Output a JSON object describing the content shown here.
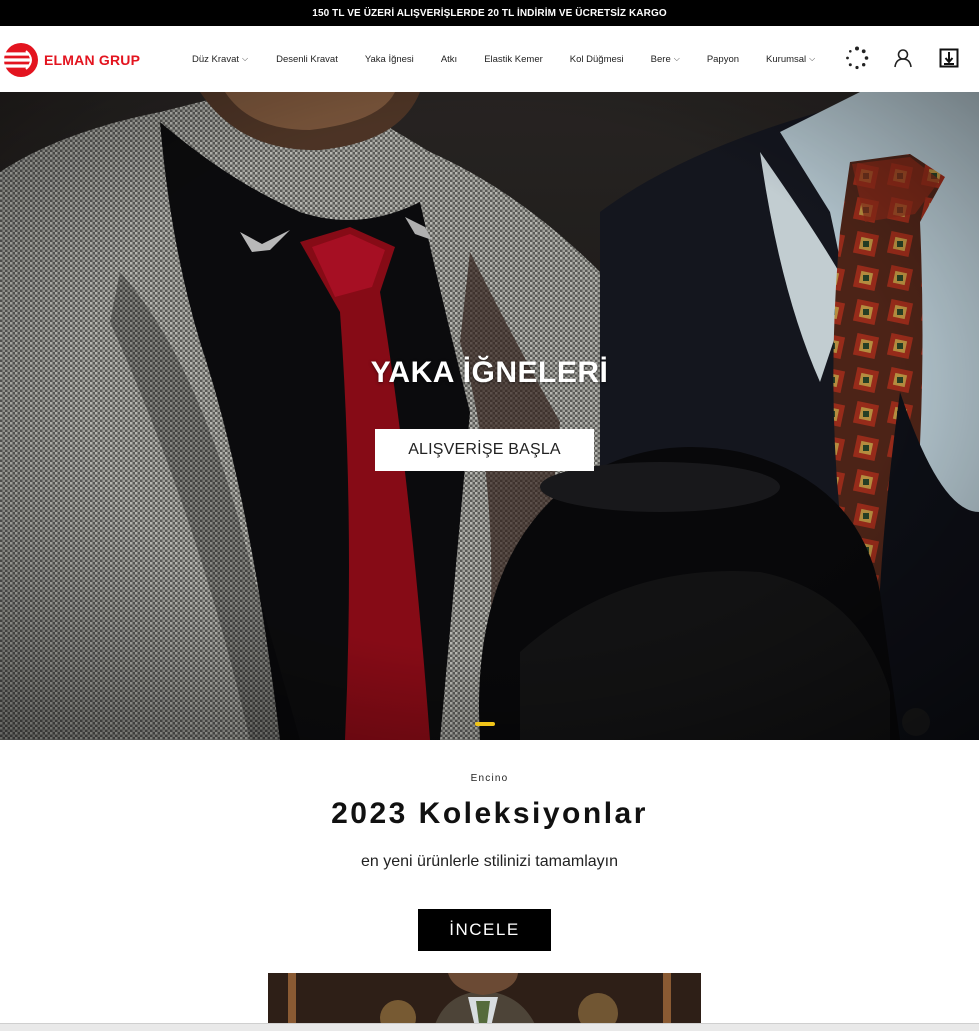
{
  "announcement": "150 TL VE ÜZERİ ALIŞVERİŞLERDE 20 TL İNDİRİM VE ÜCRETSİZ KARGO",
  "brand": {
    "name": "ELMAN GRUP",
    "color": "#e3141f"
  },
  "nav": {
    "items": [
      {
        "label": "Düz Kravat",
        "dropdown": true
      },
      {
        "label": "Desenli Kravat",
        "dropdown": false
      },
      {
        "label": "Yaka İğnesi",
        "dropdown": false
      },
      {
        "label": "Atkı",
        "dropdown": false
      },
      {
        "label": "Elastik Kemer",
        "dropdown": false
      },
      {
        "label": "Kol Düğmesi",
        "dropdown": false
      },
      {
        "label": "Bere",
        "dropdown": true
      },
      {
        "label": "Papyon",
        "dropdown": false
      },
      {
        "label": "Kurumsal",
        "dropdown": true
      }
    ]
  },
  "header_icons": [
    "loading-spinner-icon",
    "user-icon",
    "cart-icon"
  ],
  "hero": {
    "title": "YAKA İĞNELERİ",
    "button_label": "ALIŞVERİŞE BAŞLA",
    "slide_indicator_color": "#f0c419"
  },
  "collection": {
    "eyebrow": "Encino",
    "title": "2023 Koleksiyonlar",
    "subtitle": "en yeni ürünlerle stilinizi tamamlayın",
    "button_label": "İNCELE"
  }
}
